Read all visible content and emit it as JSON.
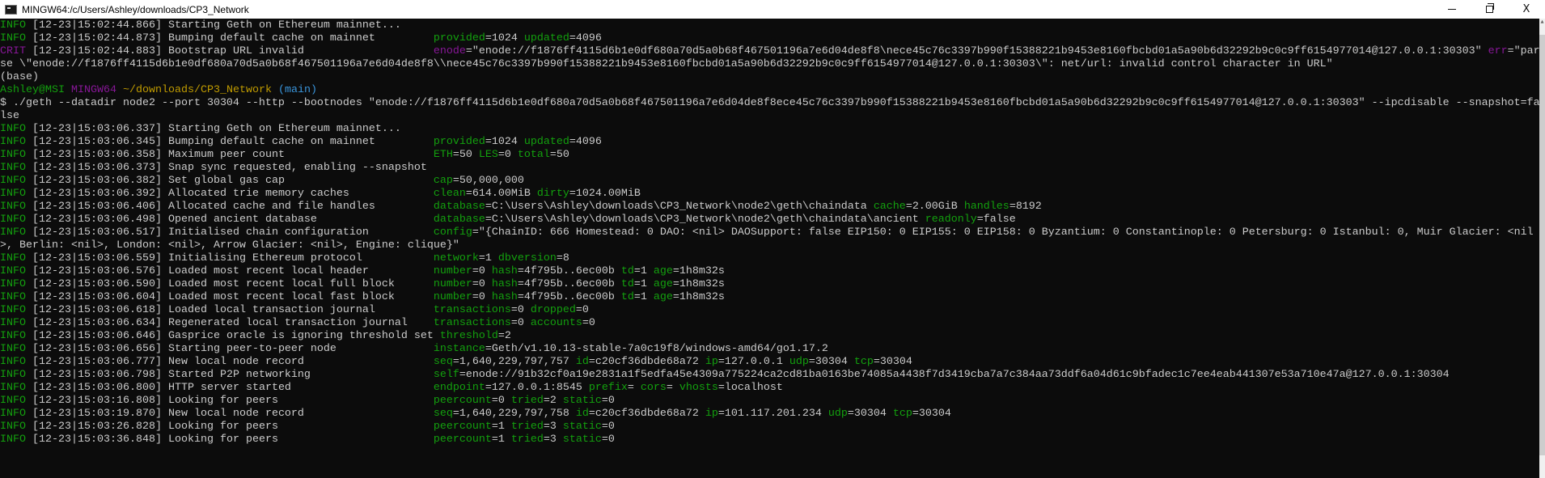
{
  "window": {
    "title": "MINGW64:/c/Users/Ashley/downloads/CP3_Network",
    "minimize_icon": "minimize-icon",
    "restore_icon": "restore-icon",
    "close_label": "X"
  },
  "colors": {
    "background": "#0c0c0c",
    "text": "#cccccc",
    "info": "#13a10e",
    "crit": "#881798",
    "prompt_user": "#13a10e",
    "prompt_host": "#881798",
    "prompt_path": "#c19c00",
    "prompt_branch": "#3a96dd"
  },
  "terminal": {
    "lines": [
      {
        "type": "log",
        "level": "INFO",
        "date": "12-23",
        "time": "15:02:44.866",
        "msg": "Starting Geth on Ethereum mainnet...",
        "ctx": ""
      },
      {
        "type": "log",
        "level": "INFO",
        "date": "12-23",
        "time": "15:02:44.873",
        "msg": "Bumping default cache on mainnet",
        "ctx": "provided=1024 updated=4096"
      },
      {
        "type": "log",
        "level": "CRIT",
        "date": "12-23",
        "time": "15:02:44.883",
        "msg": "Bootstrap URL invalid",
        "ctx": "enode=\"enode://f1876ff4115d6b1e0df680a70d5a0b68f467501196a7e6d04de8f8\\nece45c76c3397b990f15388221b9453e8160fbcbd01a5a90b6d32292b9c0c9ff6154977014@127.0.0.1:30303\" err=\"parse \\\"enode://f1876ff4115d6b1e0df680a70d5a0b68f467501196a7e6d04de8f8\\\\nece45c76c3397b990f15388221b9453e8160fbcbd01a5a90b6d32292b9c0c9ff6154977014@127.0.0.1:30303\\\": net/url: invalid control character in URL\""
      },
      {
        "type": "plain",
        "text": "(base)"
      },
      {
        "type": "prompt",
        "user": "Ashley@MSI",
        "host": "MINGW64",
        "path": "~/downloads/CP3_Network",
        "branch": "(main)"
      },
      {
        "type": "plain",
        "text": "$ ./geth --datadir node2 --port 30304 --http --bootnodes \"enode://f1876ff4115d6b1e0df680a70d5a0b68f467501196a7e6d04de8f8ece45c76c3397b990f15388221b9453e8160fbcbd01a5a90b6d32292b9c0c9ff6154977014@127.0.0.1:30303\" --ipcdisable --snapshot=false"
      },
      {
        "type": "log",
        "level": "INFO",
        "date": "12-23",
        "time": "15:03:06.337",
        "msg": "Starting Geth on Ethereum mainnet...",
        "ctx": ""
      },
      {
        "type": "log",
        "level": "INFO",
        "date": "12-23",
        "time": "15:03:06.345",
        "msg": "Bumping default cache on mainnet",
        "ctx": "provided=1024 updated=4096"
      },
      {
        "type": "log",
        "level": "INFO",
        "date": "12-23",
        "time": "15:03:06.358",
        "msg": "Maximum peer count",
        "ctx": "ETH=50 LES=0 total=50"
      },
      {
        "type": "log",
        "level": "INFO",
        "date": "12-23",
        "time": "15:03:06.373",
        "msg": "Snap sync requested, enabling --snapshot",
        "ctx": ""
      },
      {
        "type": "log",
        "level": "INFO",
        "date": "12-23",
        "time": "15:03:06.382",
        "msg": "Set global gas cap",
        "ctx": "cap=50,000,000"
      },
      {
        "type": "log",
        "level": "INFO",
        "date": "12-23",
        "time": "15:03:06.392",
        "msg": "Allocated trie memory caches",
        "ctx": "clean=614.00MiB dirty=1024.00MiB"
      },
      {
        "type": "log",
        "level": "INFO",
        "date": "12-23",
        "time": "15:03:06.406",
        "msg": "Allocated cache and file handles",
        "ctx": "database=C:\\Users\\Ashley\\downloads\\CP3_Network\\node2\\geth\\chaindata cache=2.00GiB handles=8192"
      },
      {
        "type": "log",
        "level": "INFO",
        "date": "12-23",
        "time": "15:03:06.498",
        "msg": "Opened ancient database",
        "ctx": "database=C:\\Users\\Ashley\\downloads\\CP3_Network\\node2\\geth\\chaindata\\ancient readonly=false"
      },
      {
        "type": "log",
        "level": "INFO",
        "date": "12-23",
        "time": "15:03:06.517",
        "msg": "Initialised chain configuration",
        "ctx": "config=\"{ChainID: 666 Homestead: 0 DAO: <nil> DAOSupport: false EIP150: 0 EIP155: 0 EIP158: 0 Byzantium: 0 Constantinople: 0 Petersburg: 0 Istanbul: 0, Muir Glacier: <nil>, Berlin: <nil>, London: <nil>, Arrow Glacier: <nil>, Engine: clique}\""
      },
      {
        "type": "log",
        "level": "INFO",
        "date": "12-23",
        "time": "15:03:06.559",
        "msg": "Initialising Ethereum protocol",
        "ctx": "network=1 dbversion=8"
      },
      {
        "type": "log",
        "level": "INFO",
        "date": "12-23",
        "time": "15:03:06.576",
        "msg": "Loaded most recent local header",
        "ctx": "number=0 hash=4f795b..6ec00b td=1 age=1h8m32s"
      },
      {
        "type": "log",
        "level": "INFO",
        "date": "12-23",
        "time": "15:03:06.590",
        "msg": "Loaded most recent local full block",
        "ctx": "number=0 hash=4f795b..6ec00b td=1 age=1h8m32s"
      },
      {
        "type": "log",
        "level": "INFO",
        "date": "12-23",
        "time": "15:03:06.604",
        "msg": "Loaded most recent local fast block",
        "ctx": "number=0 hash=4f795b..6ec00b td=1 age=1h8m32s"
      },
      {
        "type": "log",
        "level": "INFO",
        "date": "12-23",
        "time": "15:03:06.618",
        "msg": "Loaded local transaction journal",
        "ctx": "transactions=0 dropped=0"
      },
      {
        "type": "log",
        "level": "INFO",
        "date": "12-23",
        "time": "15:03:06.634",
        "msg": "Regenerated local transaction journal",
        "ctx": "transactions=0 accounts=0"
      },
      {
        "type": "log",
        "level": "INFO",
        "date": "12-23",
        "time": "15:03:06.646",
        "msg": "Gasprice oracle is ignoring threshold set",
        "ctx": "threshold=2"
      },
      {
        "type": "log",
        "level": "INFO",
        "date": "12-23",
        "time": "15:03:06.656",
        "msg": "Starting peer-to-peer node",
        "ctx": "instance=Geth/v1.10.13-stable-7a0c19f8/windows-amd64/go1.17.2"
      },
      {
        "type": "log",
        "level": "INFO",
        "date": "12-23",
        "time": "15:03:06.777",
        "msg": "New local node record",
        "ctx": "seq=1,640,229,797,757 id=c20cf36dbde68a72 ip=127.0.0.1 udp=30304 tcp=30304"
      },
      {
        "type": "log",
        "level": "INFO",
        "date": "12-23",
        "time": "15:03:06.798",
        "msg": "Started P2P networking",
        "ctx": "self=enode://91b32cf0a19e2831a1f5edfa45e4309a775224ca2cd81ba0163be74085a4438f7d3419cba7a7c384aa73ddf6a04d61c9bfadec1c7ee4eab441307e53a710e47a@127.0.0.1:30304"
      },
      {
        "type": "log",
        "level": "INFO",
        "date": "12-23",
        "time": "15:03:06.800",
        "msg": "HTTP server started",
        "ctx": "endpoint=127.0.0.1:8545 prefix= cors= vhosts=localhost"
      },
      {
        "type": "log",
        "level": "INFO",
        "date": "12-23",
        "time": "15:03:16.808",
        "msg": "Looking for peers",
        "ctx": "peercount=0 tried=2 static=0"
      },
      {
        "type": "log",
        "level": "INFO",
        "date": "12-23",
        "time": "15:03:19.870",
        "msg": "New local node record",
        "ctx": "seq=1,640,229,797,758 id=c20cf36dbde68a72 ip=101.117.201.234 udp=30304 tcp=30304"
      },
      {
        "type": "log",
        "level": "INFO",
        "date": "12-23",
        "time": "15:03:26.828",
        "msg": "Looking for peers",
        "ctx": "peercount=1 tried=3 static=0"
      },
      {
        "type": "log",
        "level": "INFO",
        "date": "12-23",
        "time": "15:03:36.848",
        "msg": "Looking for peers",
        "ctx": "peercount=1 tried=3 static=0"
      }
    ]
  }
}
